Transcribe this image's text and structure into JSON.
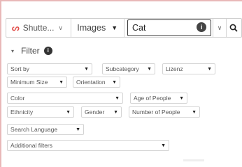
{
  "searchbar": {
    "source_label": "Shutte...",
    "source_chevron": "∨",
    "type_label": "Images",
    "type_caret": "▼",
    "query_value": "Cat",
    "expand_chevron": "∨"
  },
  "filter": {
    "collapse_glyph": "▾",
    "label": "Filter",
    "dropdowns": [
      {
        "label": "Sort by"
      },
      {
        "label": "Subcategory"
      },
      {
        "label": "Lizenz"
      },
      {
        "label": "Minimum Size"
      },
      {
        "label": "Orientation"
      },
      {
        "label": "Color"
      },
      {
        "label": "Age of People"
      },
      {
        "label": "Ethnicity"
      },
      {
        "label": "Gender"
      },
      {
        "label": "Number of People"
      },
      {
        "label": "Search Language"
      },
      {
        "label": "Additional filters"
      }
    ]
  },
  "colors": {
    "accent": "#e2504c",
    "border": "#d4d4d4",
    "query_border": "#3d3d3d"
  },
  "icons": {
    "source_logo": "shutterstock-logo",
    "query_info": "info-icon",
    "search": "magnifier-icon",
    "filter_info": "info-icon"
  }
}
